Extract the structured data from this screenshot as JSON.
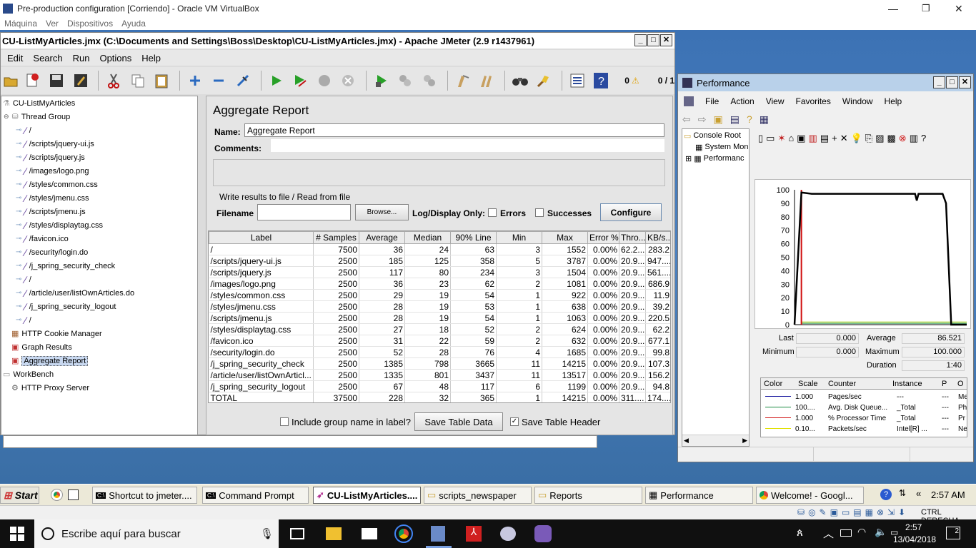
{
  "vbox": {
    "title": "Pre-production configuration [Corriendo] - Oracle VM VirtualBox",
    "menu": [
      "Máquina",
      "Ver",
      "Dispositivos",
      "Ayuda"
    ],
    "status_host_key": "CTRL DERECHA"
  },
  "jmeter": {
    "title": "CU-ListMyArticles.jmx (C:\\Documents and Settings\\Boss\\Desktop\\CU-ListMyArticles.jmx) - Apache JMeter (2.9 r1437961)",
    "menu": [
      "Edit",
      "Search",
      "Run",
      "Options",
      "Help"
    ],
    "warn_count": "0",
    "thread_status": "0 / 1",
    "tree": {
      "root": "CU-ListMyArticles",
      "thread_group": "Thread Group",
      "samplers": [
        "/",
        "/scripts/jquery-ui.js",
        "/scripts/jquery.js",
        "/images/logo.png",
        "/styles/common.css",
        "/styles/jmenu.css",
        "/scripts/jmenu.js",
        "/styles/displaytag.css",
        "/favicon.ico",
        "/security/login.do",
        "/j_spring_security_check",
        "/",
        "/article/user/listOwnArticles.do",
        "/j_spring_security_logout",
        "/"
      ],
      "cookie_manager": "HTTP Cookie Manager",
      "graph_results": "Graph Results",
      "aggregate_report": "Aggregate Report",
      "workbench": "WorkBench",
      "proxy": "HTTP Proxy Server"
    },
    "report": {
      "heading": "Aggregate Report",
      "name_label": "Name:",
      "name_value": "Aggregate Report",
      "comments_label": "Comments:",
      "write_results": "Write results to file / Read from file",
      "filename_label": "Filename",
      "browse": "Browse...",
      "log_display": "Log/Display Only:",
      "errors": "Errors",
      "successes": "Successes",
      "configure": "Configure",
      "columns": [
        "Label",
        "# Samples",
        "Average",
        "Median",
        "90% Line",
        "Min",
        "Max",
        "Error %",
        "Thro...",
        "KB/s..."
      ],
      "rows": [
        [
          "/",
          "7500",
          "36",
          "24",
          "63",
          "3",
          "1552",
          "0.00%",
          "62.2...",
          "283.2"
        ],
        [
          "/scripts/jquery-ui.js",
          "2500",
          "185",
          "125",
          "358",
          "5",
          "3787",
          "0.00%",
          "20.9...",
          "947...."
        ],
        [
          "/scripts/jquery.js",
          "2500",
          "117",
          "80",
          "234",
          "3",
          "1504",
          "0.00%",
          "20.9...",
          "561...."
        ],
        [
          "/images/logo.png",
          "2500",
          "36",
          "23",
          "62",
          "2",
          "1081",
          "0.00%",
          "20.9...",
          "686.9"
        ],
        [
          "/styles/common.css",
          "2500",
          "29",
          "19",
          "54",
          "1",
          "922",
          "0.00%",
          "20.9...",
          "11.9"
        ],
        [
          "/styles/jmenu.css",
          "2500",
          "28",
          "19",
          "53",
          "1",
          "638",
          "0.00%",
          "20.9...",
          "39.2"
        ],
        [
          "/scripts/jmenu.js",
          "2500",
          "28",
          "19",
          "54",
          "1",
          "1063",
          "0.00%",
          "20.9...",
          "220.5"
        ],
        [
          "/styles/displaytag.css",
          "2500",
          "27",
          "18",
          "52",
          "2",
          "624",
          "0.00%",
          "20.9...",
          "62.2"
        ],
        [
          "/favicon.ico",
          "2500",
          "31",
          "22",
          "59",
          "2",
          "632",
          "0.00%",
          "20.9...",
          "677.1"
        ],
        [
          "/security/login.do",
          "2500",
          "52",
          "28",
          "76",
          "4",
          "1685",
          "0.00%",
          "20.9...",
          "99.8"
        ],
        [
          "/j_spring_security_check",
          "2500",
          "1385",
          "798",
          "3665",
          "11",
          "14215",
          "0.00%",
          "20.9...",
          "107.3"
        ],
        [
          "/article/user/listOwnArticl...",
          "2500",
          "1335",
          "801",
          "3437",
          "11",
          "13517",
          "0.00%",
          "20.9...",
          "156.2"
        ],
        [
          "/j_spring_security_logout",
          "2500",
          "67",
          "48",
          "117",
          "6",
          "1199",
          "0.00%",
          "20.9...",
          "94.8"
        ],
        [
          "TOTAL",
          "37500",
          "228",
          "32",
          "365",
          "1",
          "14215",
          "0.00%",
          "311....",
          "174...."
        ]
      ],
      "include_group": "Include group name in label?",
      "save_table": "Save Table Data",
      "save_header": "Save Table Header"
    }
  },
  "perf": {
    "title": "Performance",
    "menu": [
      "File",
      "Action",
      "View",
      "Favorites",
      "Window",
      "Help"
    ],
    "tree": [
      "Console Root",
      "System Mon",
      "Performanc"
    ],
    "yticks": [
      "100",
      "90",
      "80",
      "70",
      "60",
      "50",
      "40",
      "30",
      "20",
      "10",
      "0"
    ],
    "stats": {
      "last_label": "Last",
      "last": "0.000",
      "avg_label": "Average",
      "avg": "86.521",
      "min_label": "Minimum",
      "min": "0.000",
      "max_label": "Maximum",
      "max": "100.000",
      "dur_label": "Duration",
      "dur": "1:40"
    },
    "legend_headers": [
      "Color",
      "Scale",
      "Counter",
      "Instance",
      "P",
      "O"
    ],
    "legend_rows": [
      {
        "color": "#1a1aa0",
        "scale": "1.000",
        "counter": "Pages/sec",
        "instance": "---",
        "p": "---",
        "o": "Me"
      },
      {
        "color": "#1a8a40",
        "scale": "100....",
        "counter": "Avg. Disk Queue...",
        "instance": "_Total",
        "p": "---",
        "o": "Ph"
      },
      {
        "color": "#d01010",
        "scale": "1.000",
        "counter": "% Processor Time",
        "instance": "_Total",
        "p": "---",
        "o": "Pr"
      },
      {
        "color": "#e0e000",
        "scale": "0.10...",
        "counter": "Packets/sec",
        "instance": "Intel[R] ...",
        "p": "---",
        "o": "Ne"
      }
    ],
    "chart_data": {
      "type": "line",
      "ylim": [
        0,
        100
      ],
      "series": [
        {
          "color": "#000000",
          "points": [
            [
              0,
              0
            ],
            [
              4,
              98
            ],
            [
              10,
              97
            ],
            [
              40,
              97
            ],
            [
              70,
              97
            ],
            [
              71,
              92
            ],
            [
              72,
              97
            ],
            [
              86,
              97
            ],
            [
              88,
              90
            ],
            [
              91,
              0
            ],
            [
              100,
              0
            ]
          ]
        },
        {
          "color": "#d01010",
          "points": [
            [
              4,
              0
            ],
            [
              4,
              100
            ]
          ]
        },
        {
          "color": "#1a8a40",
          "points": [
            [
              4,
              1
            ],
            [
              100,
              1
            ]
          ]
        },
        {
          "color": "#99cc00",
          "points": [
            [
              4,
              2
            ],
            [
              50,
              2
            ],
            [
              100,
              2
            ]
          ]
        }
      ]
    }
  },
  "xp_taskbar": {
    "start": "Start",
    "tasks": [
      "Shortcut to jmeter....",
      "Command Prompt",
      "CU-ListMyArticles....",
      "scripts_newspaper",
      "Reports",
      "Performance",
      "Welcome! - Googl..."
    ],
    "clock": "2:57 AM"
  },
  "host_taskbar": {
    "search": "Escribe aquí para buscar",
    "time": "2:57",
    "date": "13/04/2018",
    "notif": "2"
  }
}
